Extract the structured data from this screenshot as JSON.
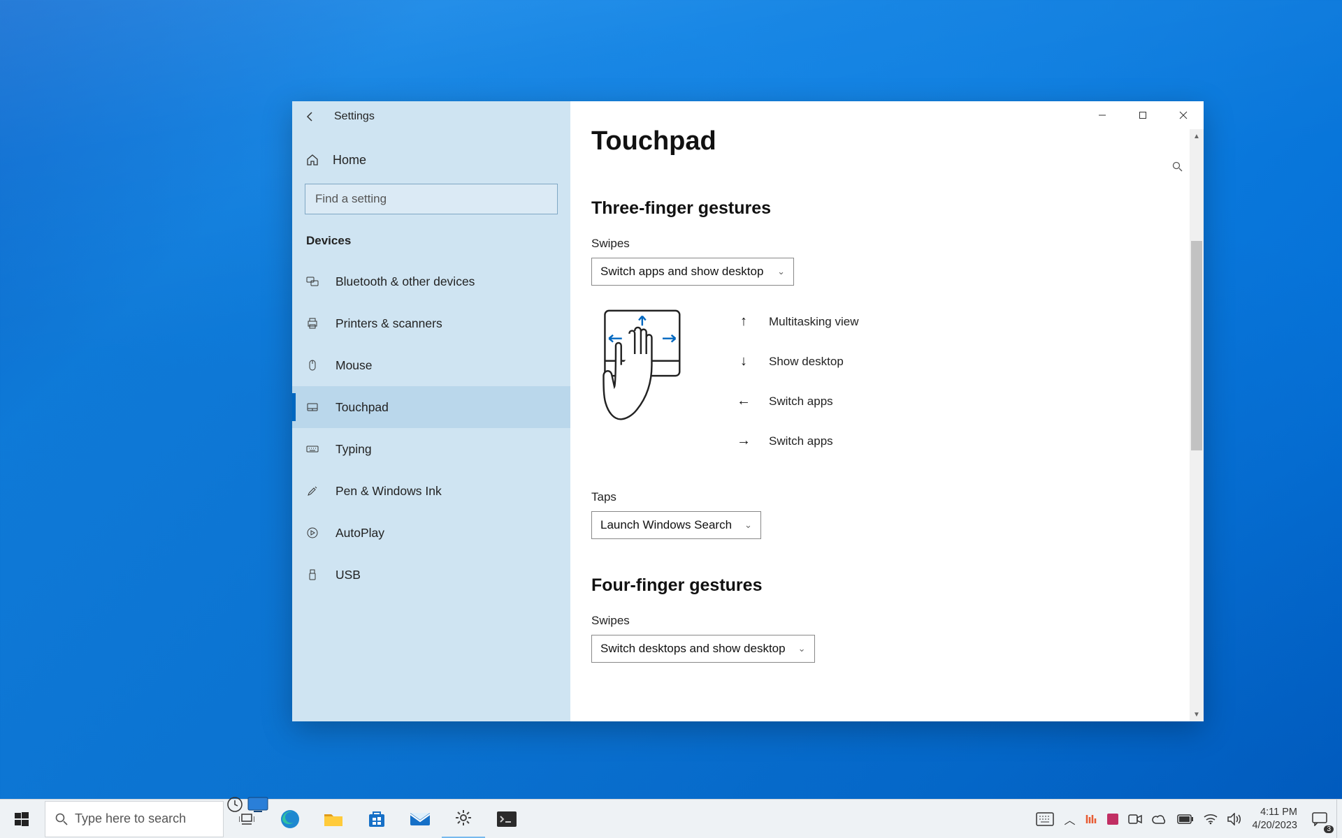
{
  "window": {
    "title": "Settings",
    "home": "Home",
    "search_placeholder": "Find a setting",
    "category": "Devices",
    "nav": [
      {
        "label": "Bluetooth & other devices"
      },
      {
        "label": "Printers & scanners"
      },
      {
        "label": "Mouse"
      },
      {
        "label": "Touchpad"
      },
      {
        "label": "Typing"
      },
      {
        "label": "Pen & Windows Ink"
      },
      {
        "label": "AutoPlay"
      },
      {
        "label": "USB"
      }
    ]
  },
  "page": {
    "title": "Touchpad",
    "three": {
      "heading": "Three-finger gestures",
      "swipes_label": "Swipes",
      "swipes_value": "Switch apps and show desktop",
      "gestures": [
        {
          "dir": "↑",
          "label": "Multitasking view"
        },
        {
          "dir": "↓",
          "label": "Show desktop"
        },
        {
          "dir": "←",
          "label": "Switch apps"
        },
        {
          "dir": "→",
          "label": "Switch apps"
        }
      ],
      "taps_label": "Taps",
      "taps_value": "Launch Windows Search"
    },
    "four": {
      "heading": "Four-finger gestures",
      "swipes_label": "Swipes",
      "swipes_value": "Switch desktops and show desktop"
    }
  },
  "taskbar": {
    "search_placeholder": "Type here to search",
    "clock_time": "4:11 PM",
    "clock_date": "4/20/2023",
    "action_badge": "3"
  }
}
